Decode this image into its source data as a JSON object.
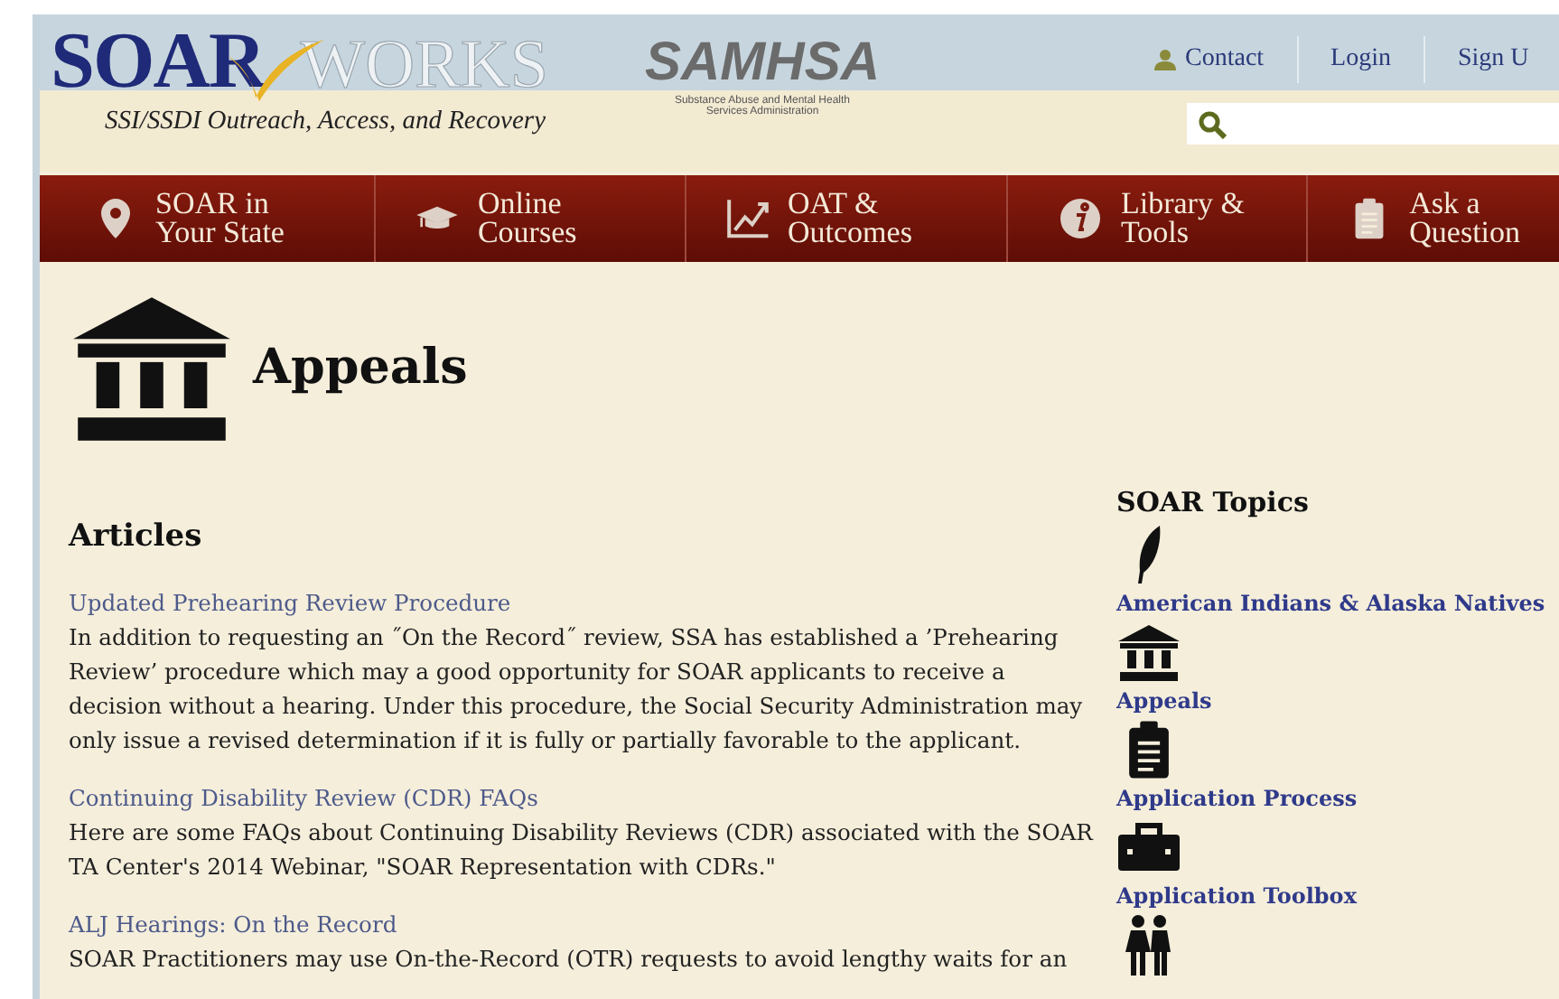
{
  "header": {
    "logo_primary": "SOAR",
    "logo_secondary": "WORKS",
    "tagline": "SSI/SSDI Outreach, Access, and Recovery",
    "partner_name": "SAMHSA",
    "partner_subtitle": "Substance Abuse and Mental Health Services Administration",
    "links": [
      "Contact",
      "Login",
      "Sign U"
    ]
  },
  "nav": [
    {
      "kind": "pin",
      "label": "SOAR in Your State"
    },
    {
      "kind": "cap",
      "label": "Online Courses"
    },
    {
      "kind": "chart",
      "label": "OAT & Outcomes"
    },
    {
      "kind": "info",
      "label": "Library & Tools"
    },
    {
      "kind": "clipboard",
      "label": "Ask a Question"
    }
  ],
  "page_title": "Appeals",
  "articles": {
    "heading": "Articles",
    "items": [
      {
        "title": "Updated Prehearing Review Procedure",
        "summary": "In addition to requesting an ˝On the Record˝ review, SSA has established a ’Prehearing Review’ procedure which may a good opportunity for SOAR applicants to receive a decision without a hearing. Under this procedure, the Social Security Administration may only issue a revised determination if it is fully or partially favorable to the applicant."
      },
      {
        "title": "Continuing Disability Review (CDR) FAQs",
        "summary": "Here are some FAQs about Continuing Disability Reviews (CDR) associated with the SOAR TA Center's 2014 Webinar, \"SOAR Representation with CDRs.\""
      },
      {
        "title": "ALJ Hearings: On the Record",
        "summary": "SOAR Practitioners may use On-the-Record (OTR) requests to avoid lengthy waits for an"
      }
    ]
  },
  "topics": {
    "heading": "SOAR Topics",
    "items": [
      {
        "kind": "feather",
        "label": "American Indians & Alaska Natives"
      },
      {
        "kind": "building",
        "label": "Appeals"
      },
      {
        "kind": "clipboard",
        "label": "Application Process"
      },
      {
        "kind": "toolbox",
        "label": "Application Toolbox"
      },
      {
        "kind": "people"
      }
    ]
  }
}
